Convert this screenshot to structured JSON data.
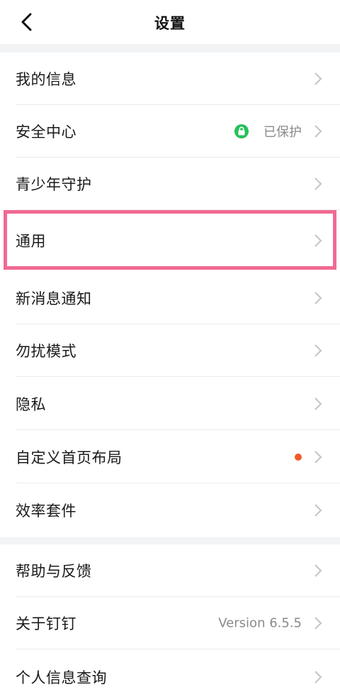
{
  "header": {
    "title": "设置",
    "back_icon": "chevron-left-icon"
  },
  "colors": {
    "accent_green": "#27c05a",
    "badge_red": "#f05a28",
    "highlight_pink": "#f06a93",
    "chevron_gray": "#c4c4c4"
  },
  "group1": {
    "items": [
      {
        "label": "我的信息"
      },
      {
        "label": "安全中心",
        "status": "已保护",
        "status_icon": "lock-icon"
      },
      {
        "label": "青少年守护"
      },
      {
        "label": "通用"
      },
      {
        "label": "新消息通知"
      },
      {
        "label": "勿扰模式"
      },
      {
        "label": "隐私"
      },
      {
        "label": "自定义首页布局",
        "badge": "red-dot"
      },
      {
        "label": "效率套件"
      }
    ]
  },
  "group2": {
    "items": [
      {
        "label": "帮助与反馈"
      },
      {
        "label": "关于钉钉",
        "status": "Version 6.5.5"
      },
      {
        "label": "个人信息查询"
      }
    ]
  }
}
